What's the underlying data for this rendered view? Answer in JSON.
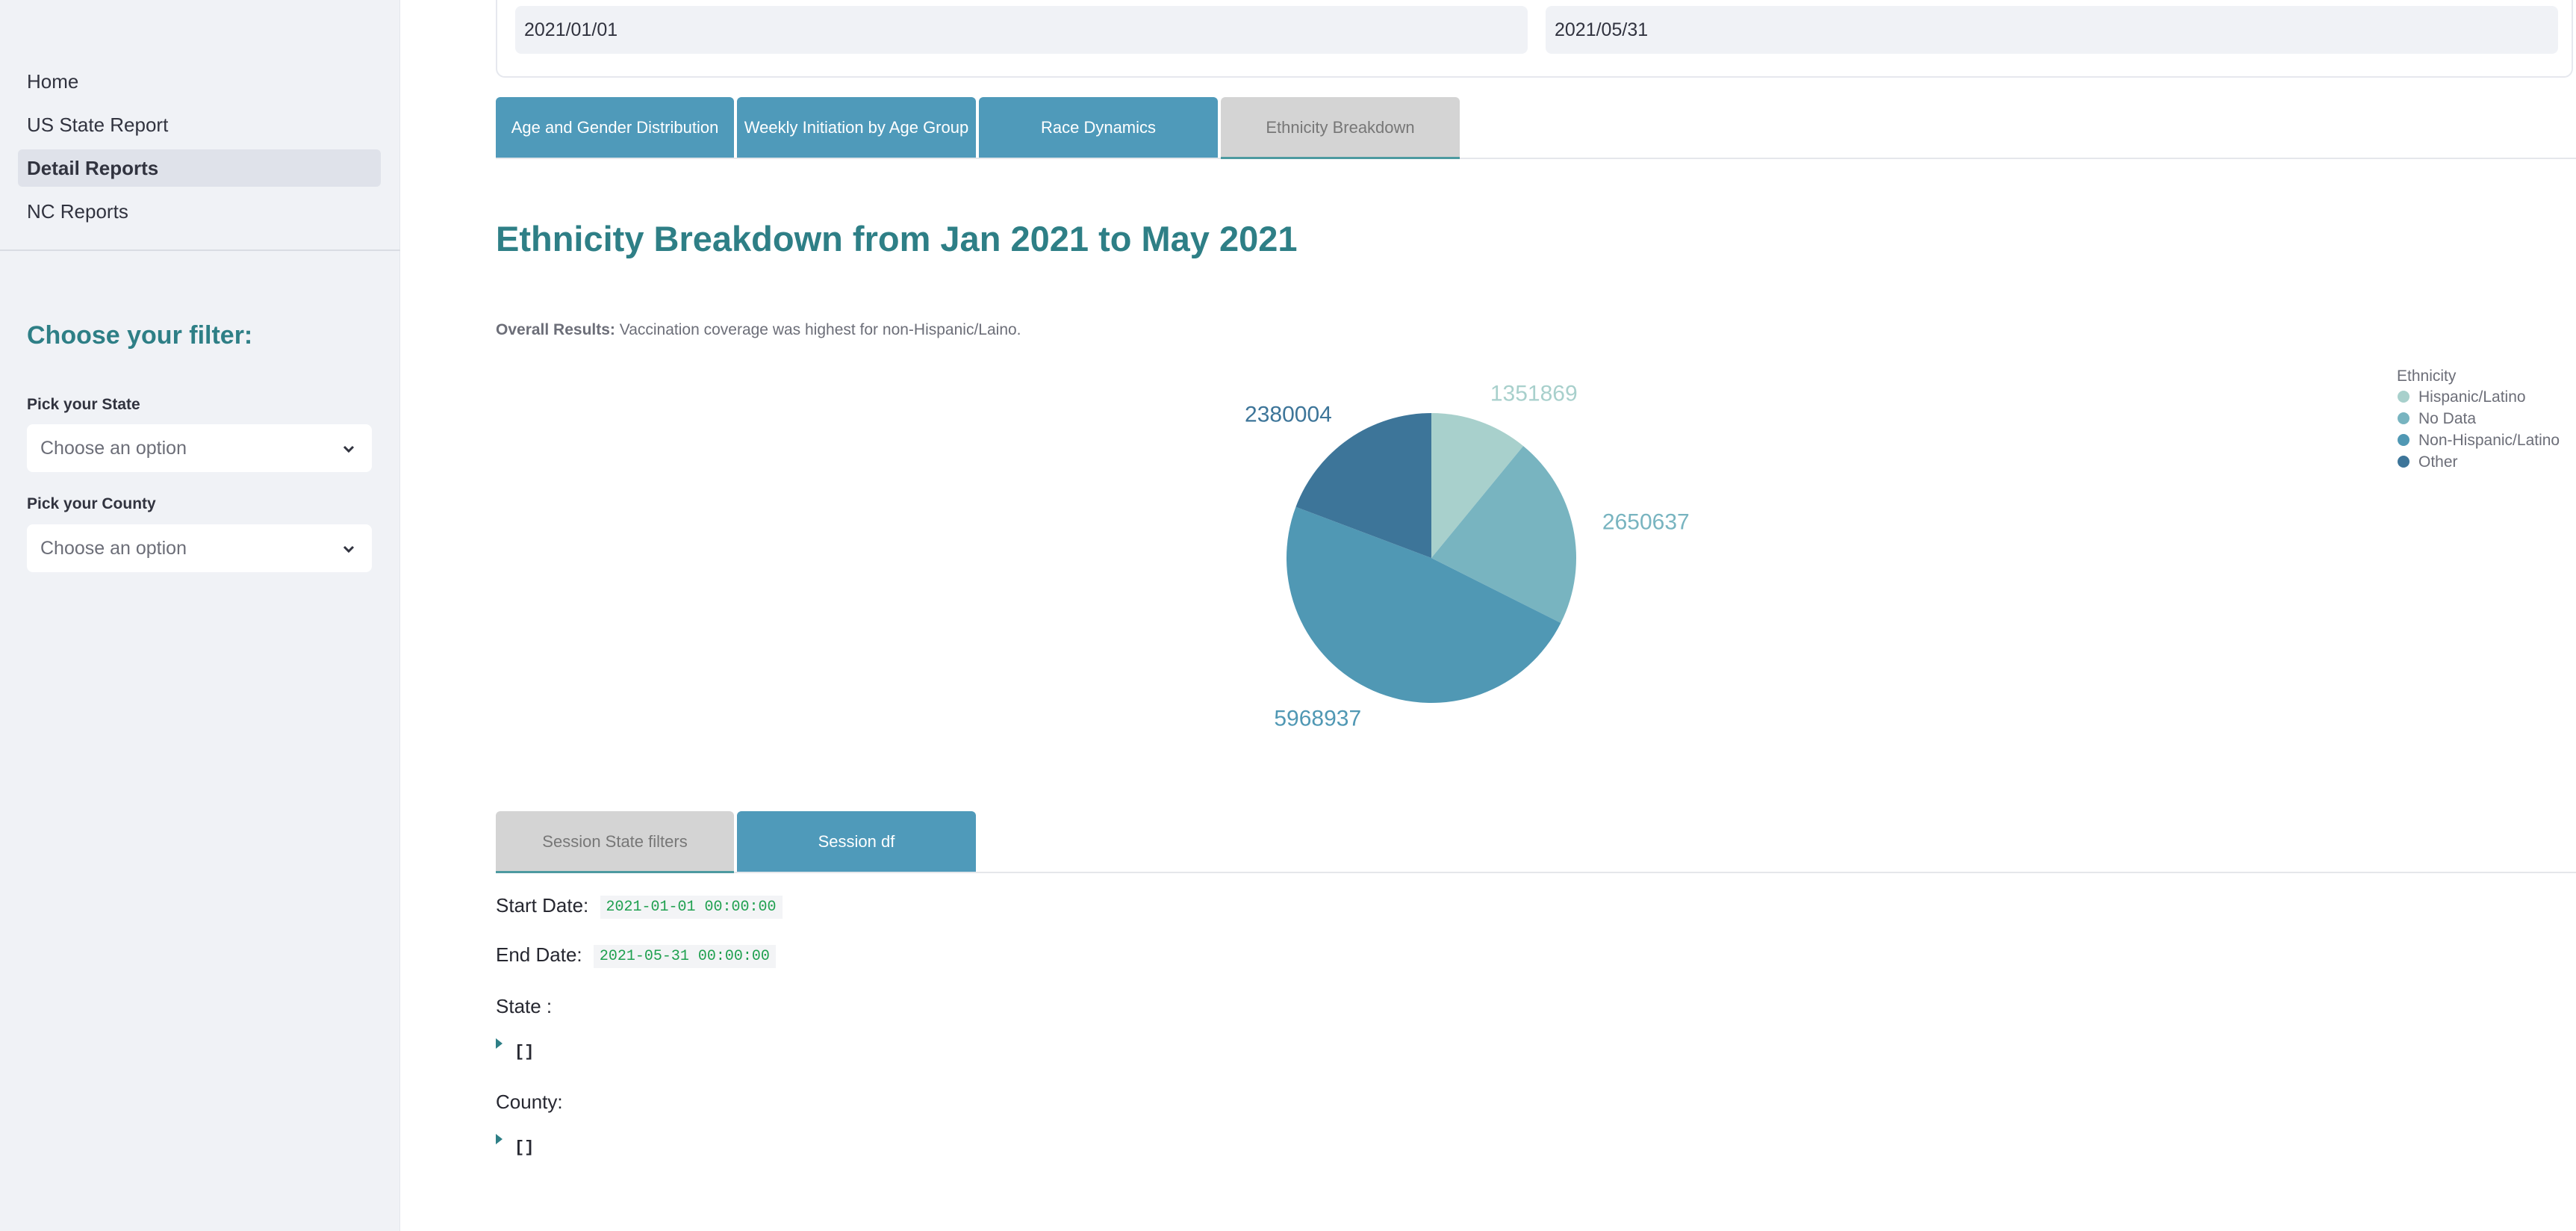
{
  "sidebar": {
    "nav": [
      {
        "label": "Home",
        "active": false
      },
      {
        "label": "US State Report",
        "active": false
      },
      {
        "label": "Detail Reports",
        "active": true
      },
      {
        "label": "NC Reports",
        "active": false
      }
    ],
    "filter_title": "Choose your filter:",
    "state_label": "Pick your State",
    "state_placeholder": "Choose an option",
    "county_label": "Pick your County",
    "county_placeholder": "Choose an option"
  },
  "dates": {
    "start": "2021/01/01",
    "end": "2021/05/31"
  },
  "report_tabs": [
    {
      "label": "Age and Gender Distribution"
    },
    {
      "label": "Weekly Initiation by Age Group"
    },
    {
      "label": "Race Dynamics"
    },
    {
      "label": "Ethnicity Breakdown"
    }
  ],
  "selected_report_tab": "Ethnicity Breakdown",
  "heading": "Ethnicity Breakdown from Jan 2021 to May 2021",
  "results": {
    "label": "Overall Results:",
    "text": "Vaccination coverage was highest for non-Hispanic/Laino."
  },
  "chart_data": {
    "type": "pie",
    "legend_title": "Ethnicity",
    "legend_position": "top-right",
    "categories": [
      "Hispanic/Latino",
      "No Data",
      "Non-Hispanic/Latino",
      "Other"
    ],
    "values": [
      1351869,
      2650637,
      5968937,
      2380004
    ],
    "labels": [
      "1351869",
      "2650637",
      "5968937",
      "2380004"
    ],
    "colors": [
      "#a8d0cc",
      "#78b4c0",
      "#5098b4",
      "#3d7599"
    ]
  },
  "session_tabs": [
    {
      "label": "Session State filters"
    },
    {
      "label": "Session df"
    }
  ],
  "selected_session_tab": "Session State filters",
  "session": {
    "start_label": "Start Date:",
    "start_value": "2021-01-01 00:00:00",
    "end_label": "End Date:",
    "end_value": "2021-05-31 00:00:00",
    "state_label": "State :",
    "state_value": "[]",
    "county_label": "County:",
    "county_value": "[]"
  }
}
